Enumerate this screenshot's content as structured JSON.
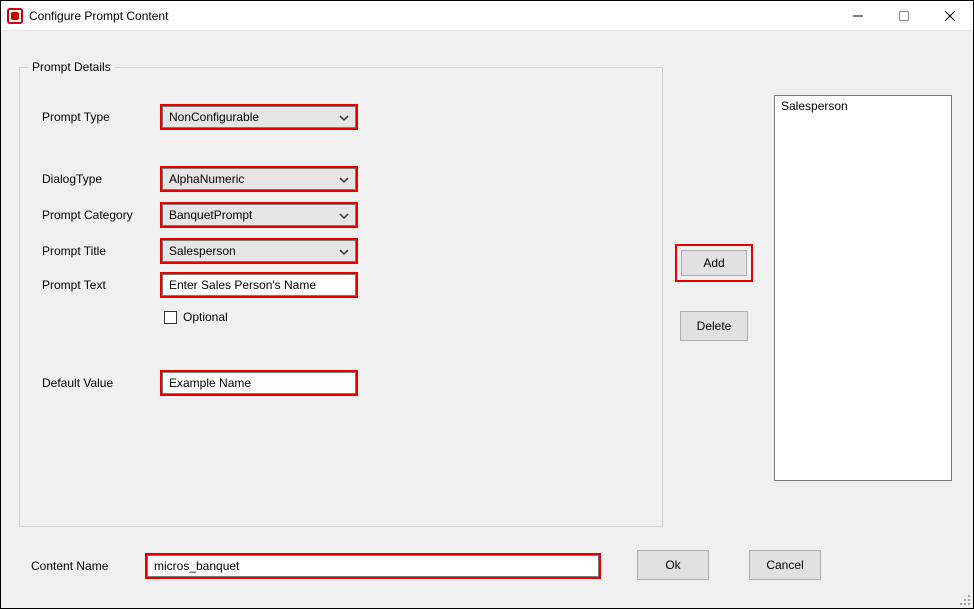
{
  "window": {
    "title": "Configure Prompt Content"
  },
  "group": {
    "legend": "Prompt Details"
  },
  "labels": {
    "prompt_type": "Prompt Type",
    "dialog_type": "DialogType",
    "prompt_category": "Prompt Category",
    "prompt_title": "Prompt Title",
    "prompt_text": "Prompt Text",
    "optional": "Optional",
    "default_value": "Default Value",
    "content_name": "Content Name"
  },
  "values": {
    "prompt_type": "NonConfigurable",
    "dialog_type": "AlphaNumeric",
    "prompt_category": "BanquetPrompt",
    "prompt_title": "Salesperson",
    "prompt_text": "Enter Sales Person's Name",
    "default_value": "Example Name",
    "content_name": "micros_banquet"
  },
  "buttons": {
    "add": "Add",
    "delete": "Delete",
    "ok": "Ok",
    "cancel": "Cancel"
  },
  "list": {
    "items": [
      "Salesperson"
    ]
  }
}
